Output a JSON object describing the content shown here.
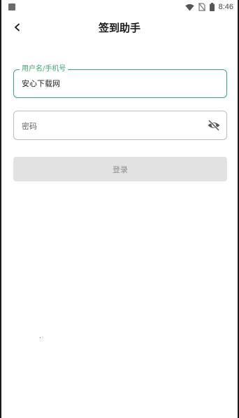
{
  "status_bar": {
    "time": "8:46",
    "icons": [
      "notification-square-icon",
      "wifi-icon",
      "no-sim-icon",
      "battery-icon"
    ]
  },
  "app_bar": {
    "title": "签到助手",
    "back_icon": "chevron-left-icon"
  },
  "login_form": {
    "username": {
      "label": "用户名/手机号",
      "value": "安心下载网",
      "state": "focused"
    },
    "password": {
      "placeholder": "密码",
      "visibility_icon": "eye-off-icon"
    },
    "submit_label": "登录"
  },
  "colors": {
    "accent": "#3aa876",
    "button_disabled_bg": "#e2e2e2",
    "button_disabled_text": "#8d8d8d"
  }
}
